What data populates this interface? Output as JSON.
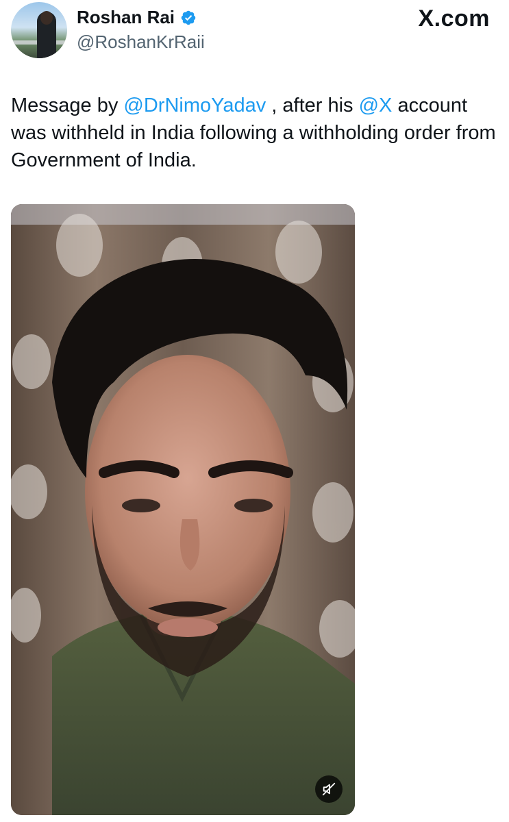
{
  "author": {
    "display_name": "Roshan Rai",
    "handle": "@RoshanKrRaii",
    "verified": true
  },
  "brand": {
    "label": "X.com"
  },
  "tweet": {
    "text_prefix": "Message by ",
    "mention_1": "@DrNimoYadav",
    "text_middle": " , after his ",
    "mention_2": "@X",
    "text_suffix": " account was withheld in India following a withholding order from Government of India."
  },
  "media": {
    "type": "video",
    "muted": true
  },
  "colors": {
    "link": "#1d9bf0",
    "verified_badge": "#1d9bf0",
    "secondary_text": "#536471"
  },
  "icons": {
    "verified": "verified-badge-icon",
    "mute": "speaker-muted-icon"
  }
}
